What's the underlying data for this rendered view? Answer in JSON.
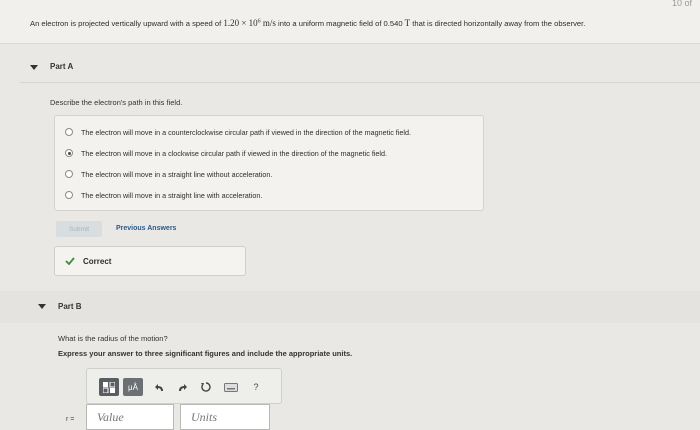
{
  "problem": {
    "text_before": "An electron is projected vertically upward with a speed of ",
    "speed_value": "1.20 × 10",
    "speed_exp": "6",
    "speed_unit": " m/s",
    "text_middle": " into a uniform magnetic field of 0.540 ",
    "field_unit": "T",
    "text_after": " that is directed horizontally away from the observer.",
    "corner": "10 of"
  },
  "part_a": {
    "title": "Part A",
    "prompt": "Describe the electron's path in this field.",
    "options": [
      {
        "label": "The electron will move in a counterclockwise circular path if viewed in the direction of the magnetic field.",
        "selected": false
      },
      {
        "label": "The electron will move in a clockwise circular path if viewed in the direction of the magnetic field.",
        "selected": true
      },
      {
        "label": "The electron will move in a straight line without acceleration.",
        "selected": false
      },
      {
        "label": "The electron will move in a straight line with acceleration.",
        "selected": false
      }
    ],
    "submit_label": "Submit",
    "previous_answers_label": "Previous Answers",
    "feedback": "Correct"
  },
  "part_b": {
    "title": "Part B",
    "question": "What is the radius of the motion?",
    "instruction": "Express your answer to three significant figures and include the appropriate units.",
    "toolbar": {
      "template_icon": "template-icon",
      "units_label": "μÅ",
      "help_label": "?"
    },
    "variable_label": "r =",
    "value_placeholder": "Value",
    "units_placeholder": "Units"
  },
  "colors": {
    "link": "#2a5a8a",
    "check": "#3f8a3c",
    "toolbar_dark": "#5a5e63"
  }
}
